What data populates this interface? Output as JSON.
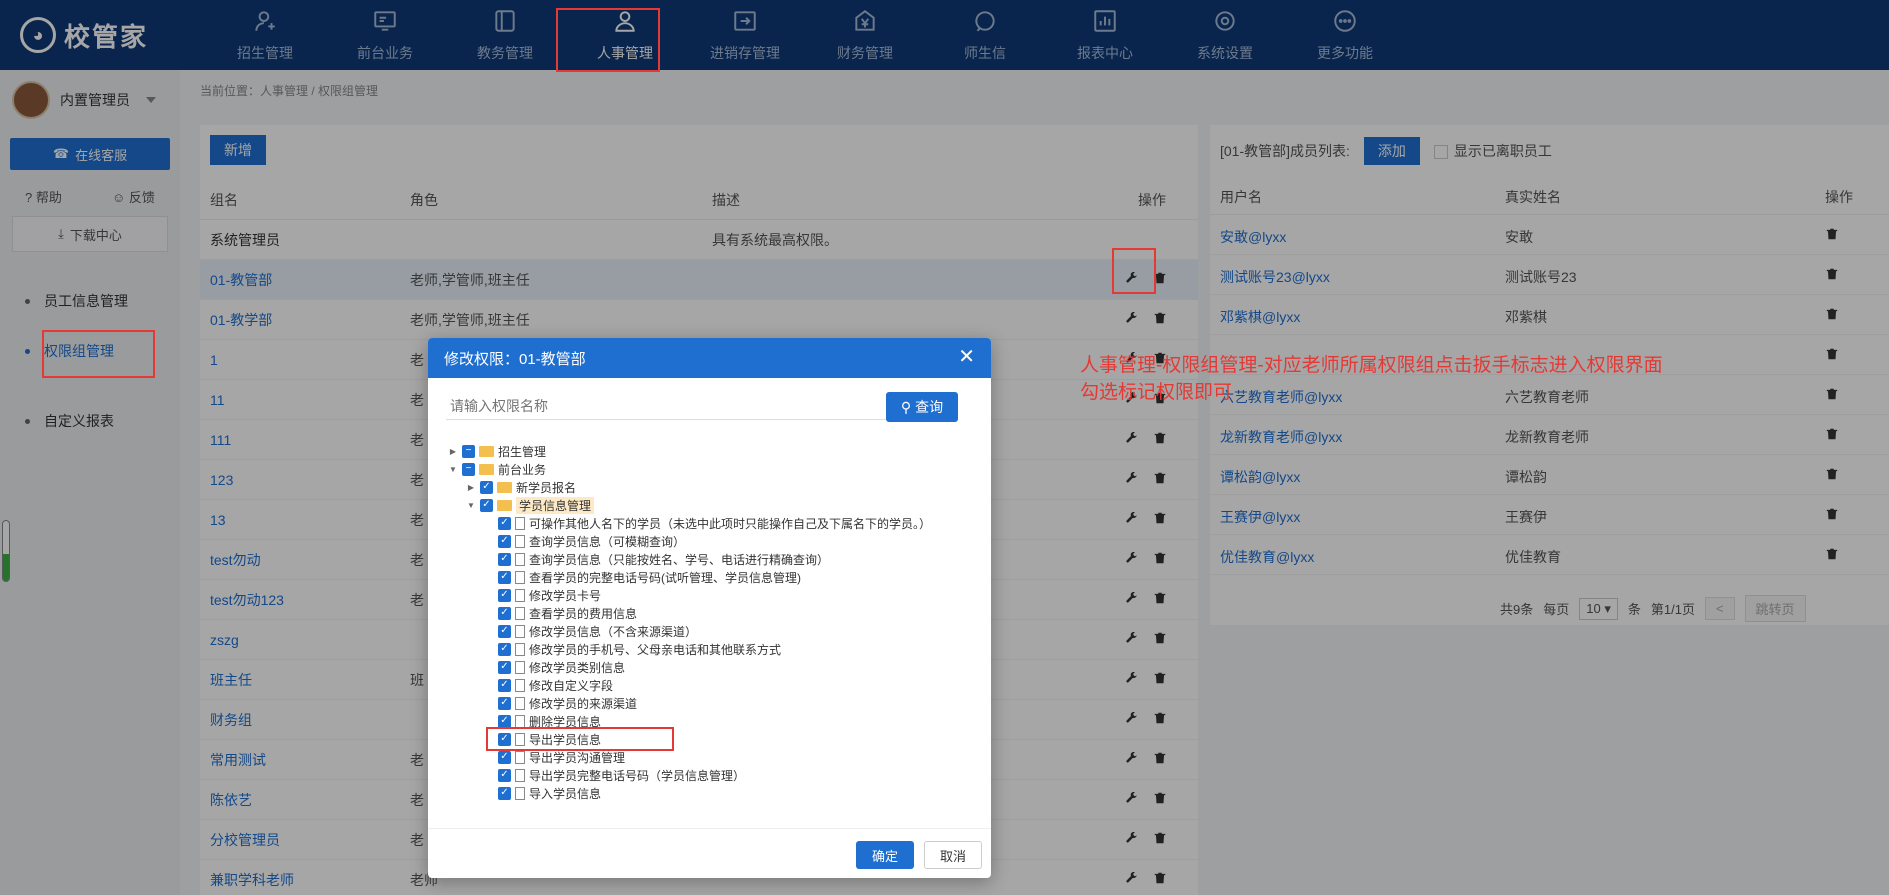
{
  "app": {
    "logo_text": "校管家"
  },
  "nav": [
    {
      "label": "招生管理",
      "icon": "user-plus-icon"
    },
    {
      "label": "前台业务",
      "icon": "monitor-icon"
    },
    {
      "label": "教务管理",
      "icon": "book-icon"
    },
    {
      "label": "人事管理",
      "icon": "person-icon",
      "active": true
    },
    {
      "label": "进销存管理",
      "icon": "inbox-arrow-icon"
    },
    {
      "label": "财务管理",
      "icon": "yen-icon"
    },
    {
      "label": "师生信",
      "icon": "chat-icon"
    },
    {
      "label": "报表中心",
      "icon": "chart-icon"
    },
    {
      "label": "系统设置",
      "icon": "settings-icon"
    },
    {
      "label": "更多功能",
      "icon": "more-icon"
    }
  ],
  "sidebar": {
    "user": "内置管理员",
    "service": "在线客服",
    "help": "帮助",
    "feedback": "反馈",
    "download": "下载中心",
    "items": [
      {
        "label": "员工信息管理"
      },
      {
        "label": "权限组管理",
        "active": true
      },
      {
        "label": "自定义报表"
      }
    ]
  },
  "breadcrumb": "当前位置：人事管理 / 权限组管理",
  "main": {
    "add_label": "新增",
    "headers": {
      "name": "组名",
      "role": "角色",
      "desc": "描述",
      "ops": "操作"
    },
    "rows": [
      {
        "name": "系统管理员",
        "role": "",
        "desc": "具有系统最高权限。"
      },
      {
        "name": "01-教管部",
        "role": "老师,学管师,班主任",
        "desc": ""
      },
      {
        "name": "01-教学部",
        "role": "老师,学管师,班主任",
        "desc": ""
      },
      {
        "name": "1",
        "role": "老",
        "desc": ""
      },
      {
        "name": "11",
        "role": "老",
        "desc": ""
      },
      {
        "name": "111",
        "role": "老",
        "desc": ""
      },
      {
        "name": "123",
        "role": "老",
        "desc": ""
      },
      {
        "name": "13",
        "role": "老",
        "desc": ""
      },
      {
        "name": "test勿动",
        "role": "老",
        "desc": ""
      },
      {
        "name": "test勿动123",
        "role": "老",
        "desc": ""
      },
      {
        "name": "zszg",
        "role": "",
        "desc": ""
      },
      {
        "name": "班主任",
        "role": "班",
        "desc": ""
      },
      {
        "name": "财务组",
        "role": "",
        "desc": ""
      },
      {
        "name": "常用测试",
        "role": "老",
        "desc": ""
      },
      {
        "name": "陈依艺",
        "role": "老",
        "desc": ""
      },
      {
        "name": "分校管理员",
        "role": "老",
        "desc": ""
      },
      {
        "name": "兼职学科老师",
        "role": "老师",
        "desc": ""
      }
    ]
  },
  "right": {
    "title": "[01-教管部]成员列表:",
    "add_label": "添加",
    "show_resigned": "显示已离职员工",
    "headers": {
      "user": "用户名",
      "real": "真实姓名",
      "ops": "操作"
    },
    "rows": [
      {
        "user": "安敢@lyxx",
        "real": "安敢"
      },
      {
        "user": "测试账号23@lyxx",
        "real": "测试账号23"
      },
      {
        "user": "邓紫棋@lyxx",
        "real": "邓紫棋"
      },
      {
        "user": "",
        "real": ""
      },
      {
        "user": "六艺教育老师@lyxx",
        "real": "六艺教育老师"
      },
      {
        "user": "龙新教育老师@lyxx",
        "real": "龙新教育老师"
      },
      {
        "user": "谭松韵@lyxx",
        "real": "谭松韵"
      },
      {
        "user": "王赛伊@lyxx",
        "real": "王赛伊"
      },
      {
        "user": "优佳教育@lyxx",
        "real": "优佳教育"
      }
    ],
    "pager": {
      "total": "共9条",
      "per_page_label": "每页",
      "per_page": "10",
      "unit": "条",
      "page": "第1/1页",
      "prev": "<",
      "next_label": "跳转页"
    }
  },
  "modal": {
    "title": "修改权限：01-教管部",
    "close": "✕",
    "search_placeholder": "请输入权限名称",
    "query": "查询",
    "tree": [
      {
        "label": "招生管理",
        "level": 0,
        "arrow": "▶",
        "type": "folder",
        "state": "partial"
      },
      {
        "label": "前台业务",
        "level": 0,
        "arrow": "▼",
        "type": "folder",
        "state": "partial"
      },
      {
        "label": "新学员报名",
        "level": 1,
        "arrow": "▶",
        "type": "folder",
        "state": "checked"
      },
      {
        "label": "学员信息管理",
        "level": 1,
        "arrow": "▼",
        "type": "folder",
        "state": "checked",
        "selected": true
      },
      {
        "label": "可操作其他人名下的学员（未选中此项时只能操作自己及下属名下的学员。）",
        "level": 2,
        "type": "file",
        "state": "checked"
      },
      {
        "label": "查询学员信息（可模糊查询）",
        "level": 2,
        "type": "file",
        "state": "checked"
      },
      {
        "label": "查询学员信息（只能按姓名、学号、电话进行精确查询）",
        "level": 2,
        "type": "file",
        "state": "checked"
      },
      {
        "label": "查看学员的完整电话号码(试听管理、学员信息管理)",
        "level": 2,
        "type": "file",
        "state": "checked"
      },
      {
        "label": "修改学员卡号",
        "level": 2,
        "type": "file",
        "state": "checked"
      },
      {
        "label": "查看学员的费用信息",
        "level": 2,
        "type": "file",
        "state": "checked"
      },
      {
        "label": "修改学员信息（不含来源渠道）",
        "level": 2,
        "type": "file",
        "state": "checked"
      },
      {
        "label": "修改学员的手机号、父母亲电话和其他联系方式",
        "level": 2,
        "type": "file",
        "state": "checked"
      },
      {
        "label": "修改学员类别信息",
        "level": 2,
        "type": "file",
        "state": "checked"
      },
      {
        "label": "修改自定义字段",
        "level": 2,
        "type": "file",
        "state": "checked"
      },
      {
        "label": "修改学员的来源渠道",
        "level": 2,
        "type": "file",
        "state": "checked"
      },
      {
        "label": "删除学员信息",
        "level": 2,
        "type": "file",
        "state": "checked"
      },
      {
        "label": "导出学员信息",
        "level": 2,
        "type": "file",
        "state": "checked"
      },
      {
        "label": "导出学员沟通管理",
        "level": 2,
        "type": "file",
        "state": "checked"
      },
      {
        "label": "导出学员完整电话号码（学员信息管理）",
        "level": 2,
        "type": "file",
        "state": "checked"
      },
      {
        "label": "导入学员信息",
        "level": 2,
        "type": "file",
        "state": "checked"
      }
    ],
    "ok": "确定",
    "cancel": "取消"
  },
  "annotation": {
    "line1": "人事管理-权限组管理-对应老师所属权限组点击扳手标志进入权限界面",
    "line2": "勾选标记权限即可",
    "color": "#e53935"
  }
}
